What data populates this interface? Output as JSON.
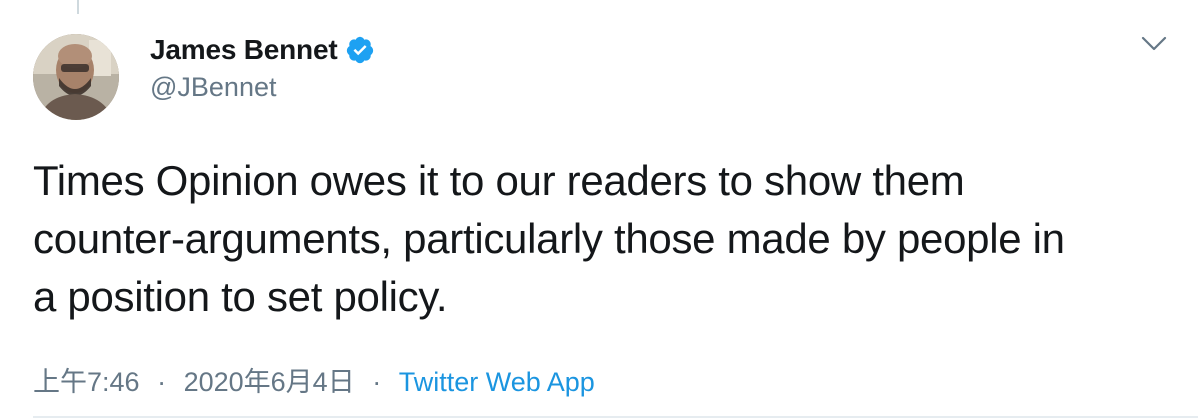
{
  "tweet": {
    "display_name": "James Bennet",
    "handle": "@JBennet",
    "verified": true,
    "text": "Times Opinion owes it to our readers to show them\ncounter-arguments, particularly those made by people in\na position to set policy.",
    "time": "上午7:46",
    "date": "2020年6月4日",
    "separator": "·",
    "source": "Twitter Web App"
  },
  "icons": {
    "verified": "verified-badge-icon",
    "menu": "chevron-down-icon"
  },
  "colors": {
    "text": "#14171a",
    "secondary": "#657786",
    "link": "#1b95e0",
    "verified": "#1da1f2"
  }
}
